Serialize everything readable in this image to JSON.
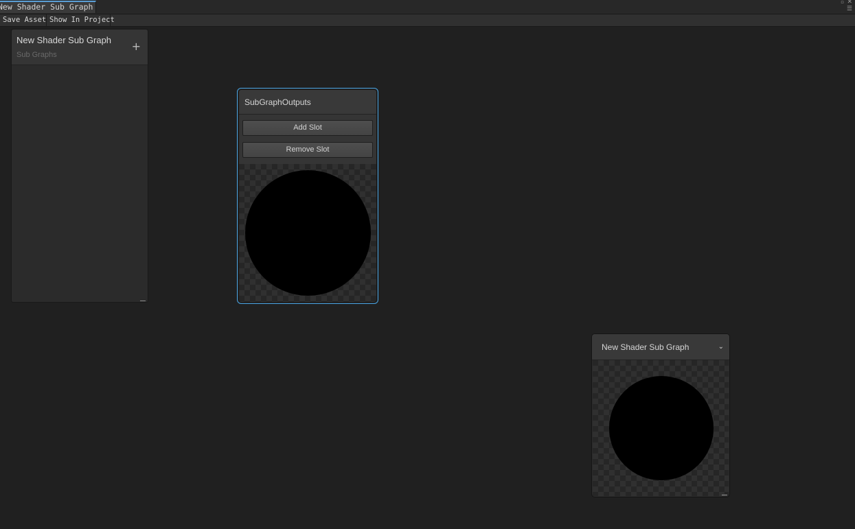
{
  "window": {
    "tab_title": "New Shader Sub Graph",
    "lock_icon": "lock-icon",
    "close_icon": "close-icon",
    "menu_icon": "context-menu-icon"
  },
  "toolbar": {
    "save_label": "Save Asset",
    "show_label": "Show In Project"
  },
  "blackboard": {
    "title": "New Shader Sub Graph",
    "subtitle": "Sub Graphs",
    "add_symbol": "+"
  },
  "outputs_node": {
    "title": "SubGraphOutputs",
    "add_slot_label": "Add Slot",
    "remove_slot_label": "Remove Slot",
    "selected": true
  },
  "subgraph_node": {
    "title": "New Shader Sub Graph",
    "collapse_symbol": "⌄"
  },
  "colors": {
    "background": "#202020",
    "selection": "#44a0e0",
    "preview_sphere": "#000000"
  }
}
